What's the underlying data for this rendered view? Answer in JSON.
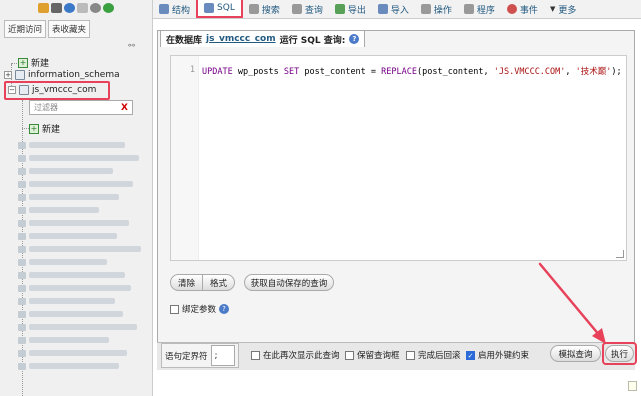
{
  "sidebar": {
    "icons": [
      "home-icon",
      "exit-icon",
      "info-icon",
      "docs-icon",
      "settings-icon",
      "reload-icon"
    ],
    "tabs": [
      {
        "label": "近期访问"
      },
      {
        "label": "表收藏夹"
      }
    ],
    "tree": {
      "new_label": "新建",
      "db1": "information_schema",
      "db2": "js_vmccc_com",
      "filter_placeholder": "过滤器",
      "filter_clear": "X",
      "table_new_label": "新建"
    }
  },
  "toolbar": {
    "tabs": [
      {
        "label": "结构",
        "icon": "structure-icon"
      },
      {
        "label": "SQL",
        "icon": "sql-icon"
      },
      {
        "label": "搜索",
        "icon": "search-icon"
      },
      {
        "label": "查询",
        "icon": "query-icon"
      },
      {
        "label": "导出",
        "icon": "export-icon"
      },
      {
        "label": "导入",
        "icon": "import-icon"
      },
      {
        "label": "操作",
        "icon": "wrench-icon"
      },
      {
        "label": "程序",
        "icon": "routines-icon"
      },
      {
        "label": "事件",
        "icon": "events-icon"
      },
      {
        "label": "更多",
        "icon": "more-icon"
      }
    ]
  },
  "query": {
    "legend_prefix": "在数据库",
    "db_name": "js_vmccc_com",
    "legend_suffix": "运行 SQL 查询:",
    "line_no": "1",
    "code": {
      "kw1": "UPDATE",
      "t1": " wp_posts ",
      "kw2": "SET",
      "t2": " post_content = ",
      "kw3": "REPLACE",
      "t3": "(post_content, ",
      "s1": "'JS.VMCCC.COM'",
      "t4": ", ",
      "s2": "'技术巅'",
      "t5": ");"
    }
  },
  "buttons": {
    "clear": "清除",
    "format": "格式",
    "get_autosaved": "获取自动保存的查询",
    "bind_params": "绑定参数",
    "simulate": "模拟查询",
    "execute": "执行"
  },
  "footer": {
    "delimiter_label": "语句定界符",
    "delimiter_value": ";",
    "opt_show_again": "在此再次显示此查询",
    "opt_keep_box": "保留查询框",
    "opt_rollback": "完成后回滚",
    "opt_fk": "启用外键约束",
    "fk_checked": true
  },
  "colors": {
    "highlight": "#e8415a",
    "link": "#235a81"
  }
}
